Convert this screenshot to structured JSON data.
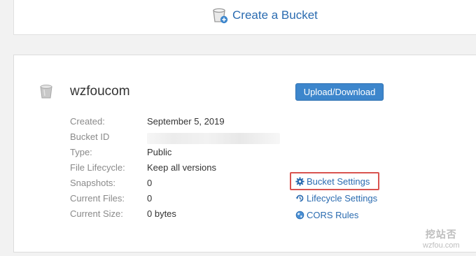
{
  "create_bucket": {
    "label": "Create a Bucket"
  },
  "bucket": {
    "name": "wzfoucom",
    "upload_button": "Upload/Download",
    "details": [
      {
        "key": "Created:",
        "value": "September 5, 2019"
      },
      {
        "key": "Bucket ID",
        "value": ""
      },
      {
        "key": "Type:",
        "value": "Public"
      },
      {
        "key": "File Lifecycle:",
        "value": "Keep all versions"
      },
      {
        "key": "Snapshots:",
        "value": "0"
      },
      {
        "key": "Current Files:",
        "value": "0"
      },
      {
        "key": "Current Size:",
        "value": "0 bytes"
      }
    ],
    "actions": [
      {
        "label": "Bucket Settings",
        "icon": "gear-icon"
      },
      {
        "label": "Lifecycle Settings",
        "icon": "history-icon"
      },
      {
        "label": "CORS Rules",
        "icon": "globe-icon"
      }
    ]
  },
  "watermark": {
    "line1": "挖站否",
    "line2": "wzfou.com"
  },
  "colors": {
    "link": "#2a6bb0",
    "button": "#3d86cc",
    "highlight": "#d9534f"
  }
}
